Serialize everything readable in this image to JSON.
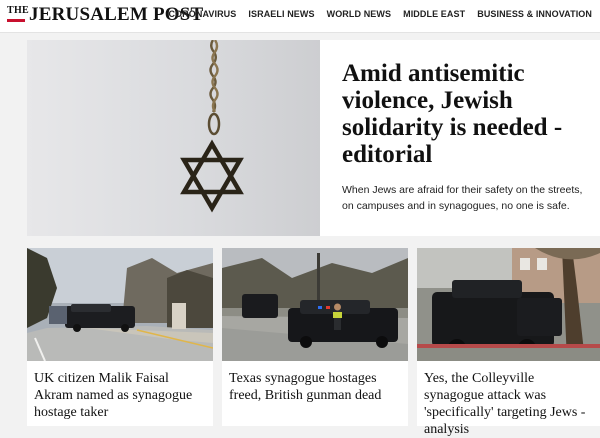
{
  "header": {
    "logo_prefix": "THE",
    "logo_name": "JERUSALEM POST",
    "brand_color": "#c8102e",
    "nav": [
      "CORONAVIRUS",
      "ISRAELI NEWS",
      "WORLD NEWS",
      "MIDDLE EAST",
      "BUSINESS & INNOVATION"
    ]
  },
  "hero": {
    "image_icon": "star-of-david-pendant",
    "title": "Amid antisemitic violence, Jewish solidarity is needed - editorial",
    "subtitle": "When Jews are afraid for their safety on the streets, on campuses and in synagogues, no one is safe."
  },
  "cards": [
    {
      "title": "UK citizen Malik Faisal Akram named as synagogue hostage taker"
    },
    {
      "title": "Texas synagogue hostages freed, British gunman dead"
    },
    {
      "title": "Yes, the Colleyville synagogue attack was 'specifically' targeting Jews - analysis"
    }
  ]
}
